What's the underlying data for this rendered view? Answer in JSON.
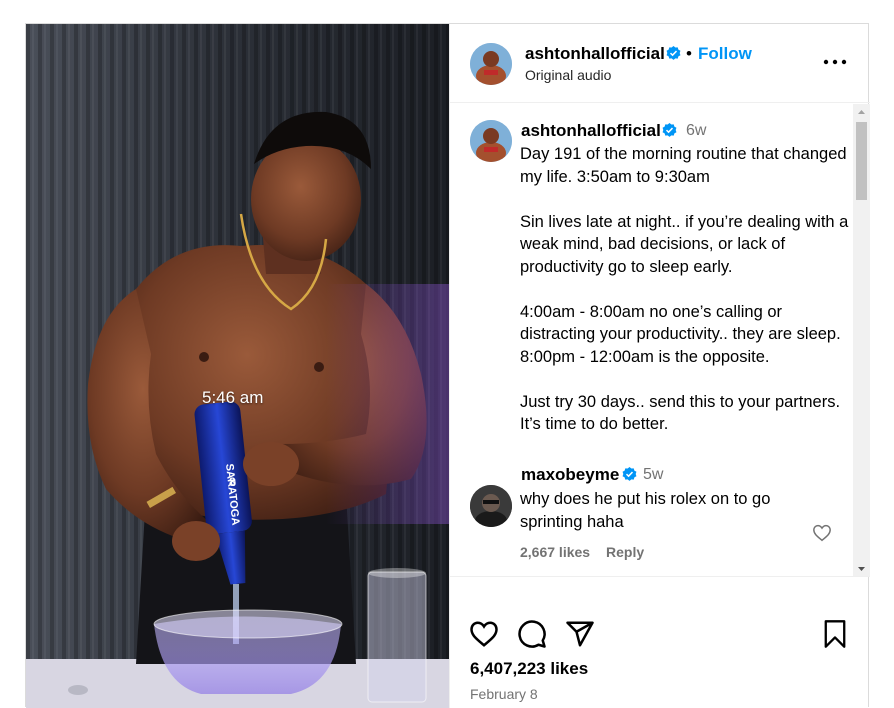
{
  "media": {
    "overlay_time": "5:46 am",
    "bottle_label_text": "SARATOGA",
    "bottle_label_number": "8"
  },
  "header": {
    "username": "ashtonhallofficial",
    "separator": "•",
    "follow_label": "Follow",
    "audio_label": "Original audio",
    "more_icon": "more-horizontal-icon"
  },
  "caption": {
    "username": "ashtonhallofficial",
    "time": "6w",
    "text": "Day 191 of the morning routine that changed my life. 3:50am to 9:30am\n\nSin lives late at night.. if you’re dealing with a weak mind, bad decisions, or lack of productivity go to sleep early.\n\n4:00am - 8:00am no one’s calling or distracting your productivity.. they are sleep. 8:00pm - 12:00am is the opposite.\n\nJust try 30 days.. send this to your partners. It’s time to do better."
  },
  "comment": {
    "username": "maxobeyme",
    "time": "5w",
    "text": "why does he put his rolex on to go sprinting haha",
    "likes": "2,667 likes",
    "reply_label": "Reply"
  },
  "actions": {
    "likes": "6,407,223 likes",
    "date": "February 8",
    "icons": [
      "heart-icon",
      "comment-icon",
      "share-icon",
      "bookmark-icon"
    ]
  },
  "colors": {
    "accent": "#0095f6",
    "verified": "#0095f6",
    "secondary_text": "#737373",
    "border": "#dbdbdb"
  }
}
